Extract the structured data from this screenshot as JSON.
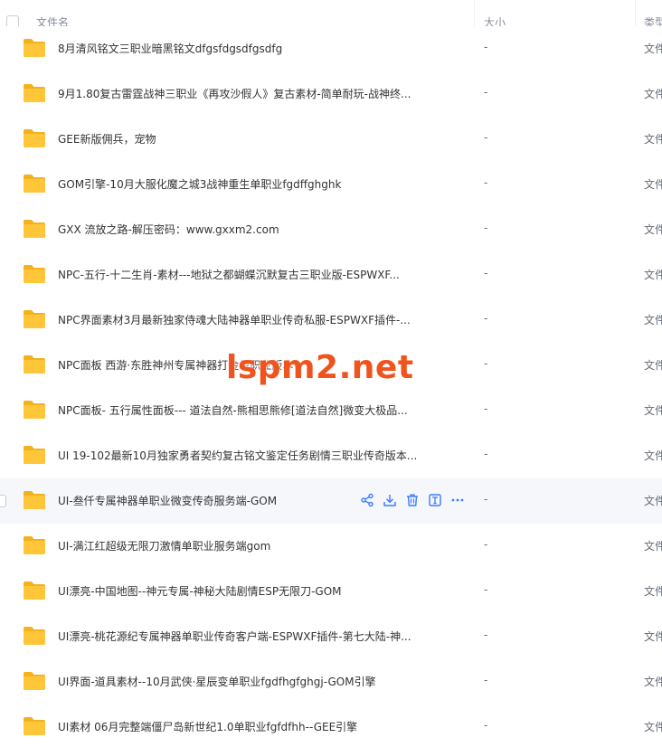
{
  "header": {
    "col_name": "文件名",
    "col_size": "大小",
    "col_type": "类型"
  },
  "colors": {
    "folder": "#ffc63a",
    "folder_dark": "#f3b21b",
    "action_icon": "#3b7cff",
    "watermark": "#f0541e"
  },
  "rows": [
    {
      "name": "8月清风铭文三职业暗黑铭文dfgsfdgsdfgsdfg",
      "size": "-",
      "type": "文件"
    },
    {
      "name": "9月1.80复古雷霆战神三职业《再攻沙假人》复古素材-简单耐玩-战神终...",
      "size": "-",
      "type": "文件"
    },
    {
      "name": "GEE新版佣兵，宠物",
      "size": "-",
      "type": "文件"
    },
    {
      "name": "GOM引擎-10月大服化魔之城3战神重生单职业fgdffghghk",
      "size": "-",
      "type": "文件"
    },
    {
      "name": "GXX 流放之路-解压密码：www.gxxm2.com",
      "size": "-",
      "type": "文件"
    },
    {
      "name": "NPC-五行-十二生肖-素材---地狱之都蝴蝶沉默复古三职业版-ESPWXF...",
      "size": "-",
      "type": "文件"
    },
    {
      "name": "NPC界面素材3月最新独家侍魂大陆神器单职业传奇私服-ESPWXF插件-...",
      "size": "-",
      "type": "文件"
    },
    {
      "name": "NPC面板 西游·东胜神州专属神器打金单职业版本",
      "size": "-",
      "type": "文件"
    },
    {
      "name": "NPC面板- 五行属性面板--- 道法自然-熊相思熊修[道法自然]微变大极品...",
      "size": "-",
      "type": "文件"
    },
    {
      "name": "UI 19-102最新10月独家勇者契约复古铭文鉴定任务剧情三职业传奇版本...",
      "size": "-",
      "type": "文件"
    },
    {
      "name": "UI-叁仟专属神器单职业微变传奇服务端-GOM",
      "size": "-",
      "type": "文件"
    },
    {
      "name": "UI-满江红超级无限刀激情单职业服务端gom",
      "size": "-",
      "type": "文件"
    },
    {
      "name": "UI漂亮-中国地图--神元专属-神秘大陆剧情ESP无限刀-GOM",
      "size": "-",
      "type": "文件"
    },
    {
      "name": "UI漂亮-桃花源纪专属神器单职业传奇客户端-ESPWXF插件-第七大陆-神...",
      "size": "-",
      "type": "文件"
    },
    {
      "name": "UI界面-道具素材--10月武侠·星辰变单职业fgdfhgfghgj-GOM引擎",
      "size": "-",
      "type": "文件"
    },
    {
      "name": "UI素材 06月完整端僵尸岛新世纪1.0单职业fgfdfhh--GEE引擎",
      "size": "-",
      "type": "文件"
    }
  ],
  "hover_actions": [
    "share-icon",
    "download-icon",
    "delete-icon",
    "rename-icon",
    "more-icon"
  ],
  "watermark": "lspm2.net"
}
